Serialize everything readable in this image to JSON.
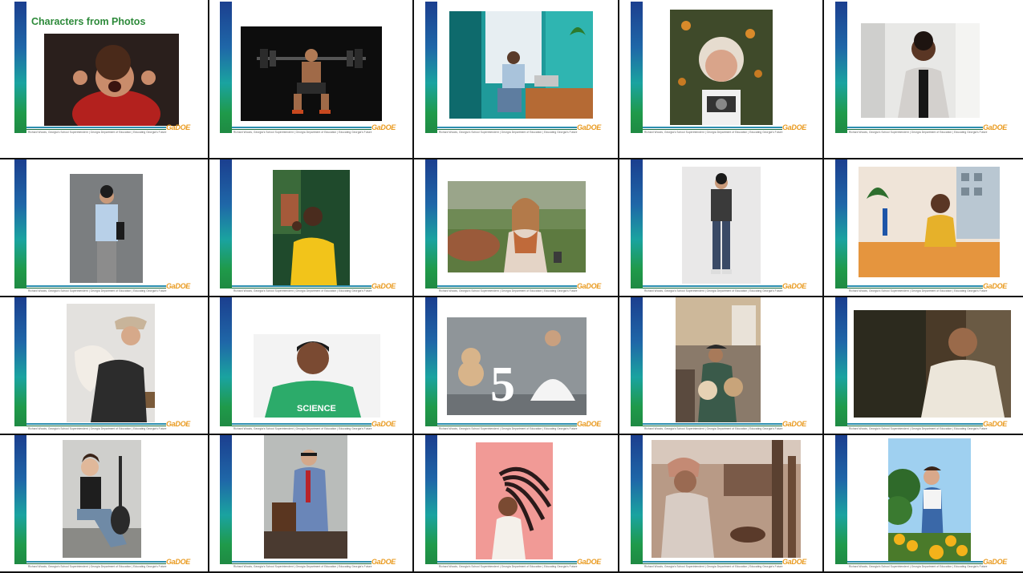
{
  "title_slide": {
    "title": "Characters from Photos"
  },
  "footer": {
    "text": "Richard Woods, Georgia's School Superintendent | Georgia Department of Education | Educating Georgia's Future",
    "logo": "GaDOE"
  },
  "photos": [
    {
      "subject": "child-shouting"
    },
    {
      "subject": "weightlifter-squat"
    },
    {
      "subject": "man-at-desk-office"
    },
    {
      "subject": "elderly-woman-camera"
    },
    {
      "subject": "woman-blazer-smiling"
    },
    {
      "subject": "man-holding-tablet"
    },
    {
      "subject": "woman-yellow-dress-waving"
    },
    {
      "subject": "woman-scarf-coffee"
    },
    {
      "subject": "young-man-standing"
    },
    {
      "subject": "woman-desk-office"
    },
    {
      "subject": "man-cap-hugging-pillow"
    },
    {
      "subject": "man-science-tshirt"
    },
    {
      "subject": "girl-teddy-number-5"
    },
    {
      "subject": "musicians-street"
    },
    {
      "subject": "elderly-man-wall"
    },
    {
      "subject": "woman-guitar-sitting"
    },
    {
      "subject": "older-man-suit-bench"
    },
    {
      "subject": "woman-hair-flip"
    },
    {
      "subject": "elderly-woman-village"
    },
    {
      "subject": "woman-sunflowers"
    }
  ]
}
